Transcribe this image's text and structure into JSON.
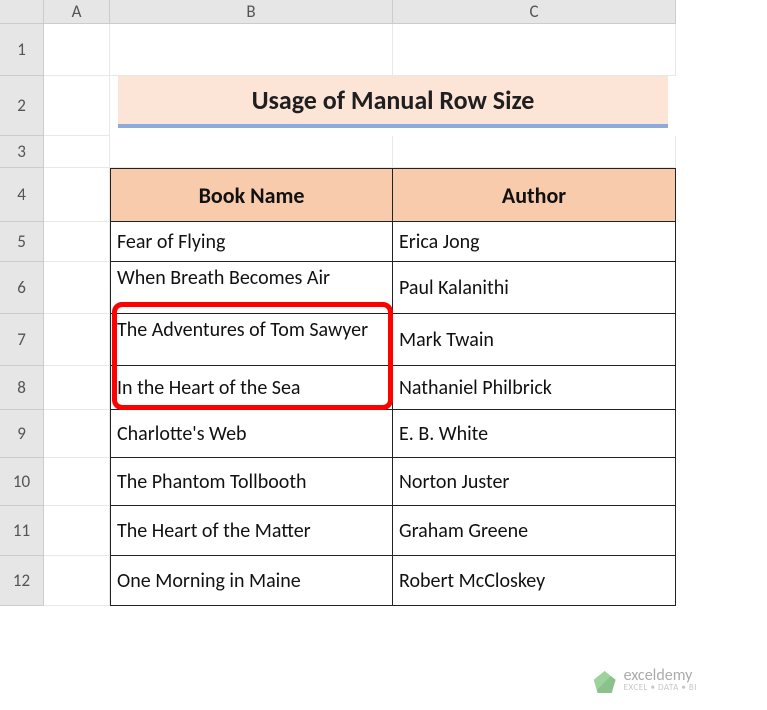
{
  "columns": [
    "A",
    "B",
    "C"
  ],
  "rows": [
    "1",
    "2",
    "3",
    "4",
    "5",
    "6",
    "7",
    "8",
    "9",
    "10",
    "11",
    "12"
  ],
  "title": "Usage of Manual Row Size",
  "headers": {
    "book": "Book Name",
    "author": "Author"
  },
  "data": [
    {
      "book": "Fear of Flying",
      "author": "Erica Jong"
    },
    {
      "book": "When Breath Becomes Air",
      "author": "Paul Kalanithi"
    },
    {
      "book": "The Adventures of Tom Sawyer",
      "author": "Mark Twain"
    },
    {
      "book": "In the Heart of the Sea",
      "author": "Nathaniel Philbrick"
    },
    {
      "book": "Charlotte's Web",
      "author": "E. B. White"
    },
    {
      "book": "The Phantom Tollbooth",
      "author": "Norton Juster"
    },
    {
      "book": "The Heart of the Matter",
      "author": "Graham Greene"
    },
    {
      "book": "One Morning in Maine",
      "author": "Robert McCloskey"
    }
  ],
  "watermark": {
    "brand": "exceldemy",
    "tagline": "EXCEL • DATA • BI"
  },
  "colors": {
    "title_bg": "#fce4d6",
    "header_bg": "#f8cbad",
    "title_underline": "#8ea9db",
    "highlight": "#ff0000"
  }
}
